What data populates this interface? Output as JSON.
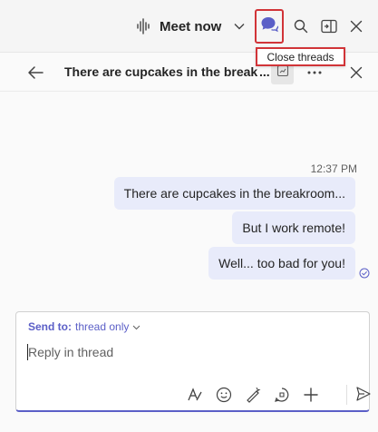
{
  "topbar": {
    "meet_now_label": "Meet now",
    "icons": [
      "audio-wave-icon",
      "chevron-down-icon",
      "threads-icon",
      "search-icon",
      "side-panel-icon",
      "close-icon"
    ]
  },
  "tooltip": {
    "text": "Close threads"
  },
  "thread_header": {
    "title": "There are cupcakes in the break",
    "icons": [
      "back-arrow-icon",
      "pinned-icon",
      "more-icon",
      "close-icon"
    ]
  },
  "messages": {
    "timestamp": "12:37 PM",
    "items": [
      {
        "text": "There are cupcakes in the breakroom..."
      },
      {
        "text": "But I work remote!"
      },
      {
        "text": "Well... too bad for you!"
      }
    ]
  },
  "reply": {
    "send_to_label": "Send to:",
    "send_to_value": "thread only",
    "placeholder": "Reply in thread"
  },
  "colors": {
    "accent": "#5b5fc7",
    "bubble": "#e8ebfa",
    "highlight": "#d13438"
  }
}
